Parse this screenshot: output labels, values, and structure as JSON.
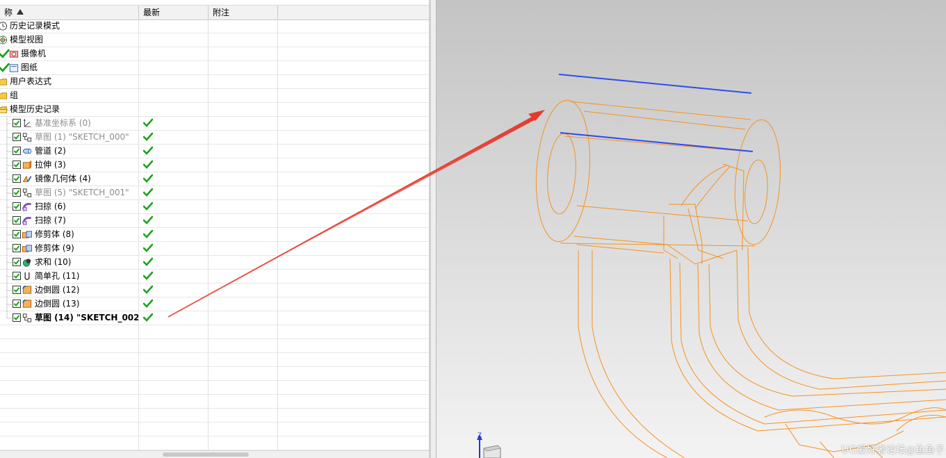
{
  "navigator": {
    "columns": [
      "称",
      "最新",
      "附注"
    ],
    "top_items": [
      {
        "label": "历史记录模式",
        "icon": "history-mode-icon"
      },
      {
        "label": "模型视图",
        "icon": "model-views-icon"
      },
      {
        "label": "摄像机",
        "icon": "camera-icon"
      },
      {
        "label": "图纸",
        "icon": "drawing-sheet-icon"
      },
      {
        "label": "用户表达式",
        "icon": "folder-icon"
      },
      {
        "label": "组",
        "icon": "folder-icon"
      },
      {
        "label": "模型历史记录",
        "icon": "folder-open-icon"
      }
    ],
    "features": [
      {
        "label": "基准坐标系 (0)",
        "icon": "datum-csys-icon",
        "grey": true,
        "bold": false
      },
      {
        "label": "草图 (1) \"SKETCH_000\"",
        "icon": "sketch-icon",
        "grey": true,
        "bold": false
      },
      {
        "label": "管道 (2)",
        "icon": "tube-icon",
        "grey": false,
        "bold": false
      },
      {
        "label": "拉伸 (3)",
        "icon": "extrude-icon",
        "grey": false,
        "bold": false
      },
      {
        "label": "镜像几何体 (4)",
        "icon": "mirror-geometry-icon",
        "grey": false,
        "bold": false
      },
      {
        "label": "草图 (5) \"SKETCH_001\"",
        "icon": "sketch-icon",
        "grey": true,
        "bold": false
      },
      {
        "label": "扫掠 (6)",
        "icon": "swept-icon",
        "grey": false,
        "bold": false
      },
      {
        "label": "扫掠 (7)",
        "icon": "swept-icon",
        "grey": false,
        "bold": false
      },
      {
        "label": "修剪体 (8)",
        "icon": "trim-body-icon",
        "grey": false,
        "bold": false
      },
      {
        "label": "修剪体 (9)",
        "icon": "trim-body-icon",
        "grey": false,
        "bold": false
      },
      {
        "label": "求和 (10)",
        "icon": "unite-icon",
        "grey": false,
        "bold": false
      },
      {
        "label": "简单孔 (11)",
        "icon": "simple-hole-icon",
        "grey": false,
        "bold": false
      },
      {
        "label": "边倒圆 (12)",
        "icon": "edge-blend-icon",
        "grey": false,
        "bold": false
      },
      {
        "label": "边倒圆 (13)",
        "icon": "edge-blend-icon",
        "grey": false,
        "bold": false
      },
      {
        "label": "草图 (14) \"SKETCH_002\"",
        "icon": "sketch-icon",
        "grey": false,
        "bold": true
      }
    ],
    "empty_rows": 9
  },
  "colors": {
    "wireframe": "#f5921e",
    "sketch_lines": "#2f4cf0",
    "annotation_arrow": "#e53a2c",
    "check_green": "#1aa31a"
  },
  "viewport": {
    "triad_axis": "Z"
  },
  "watermark": "UG爱好者论坛@鱼鱼子"
}
